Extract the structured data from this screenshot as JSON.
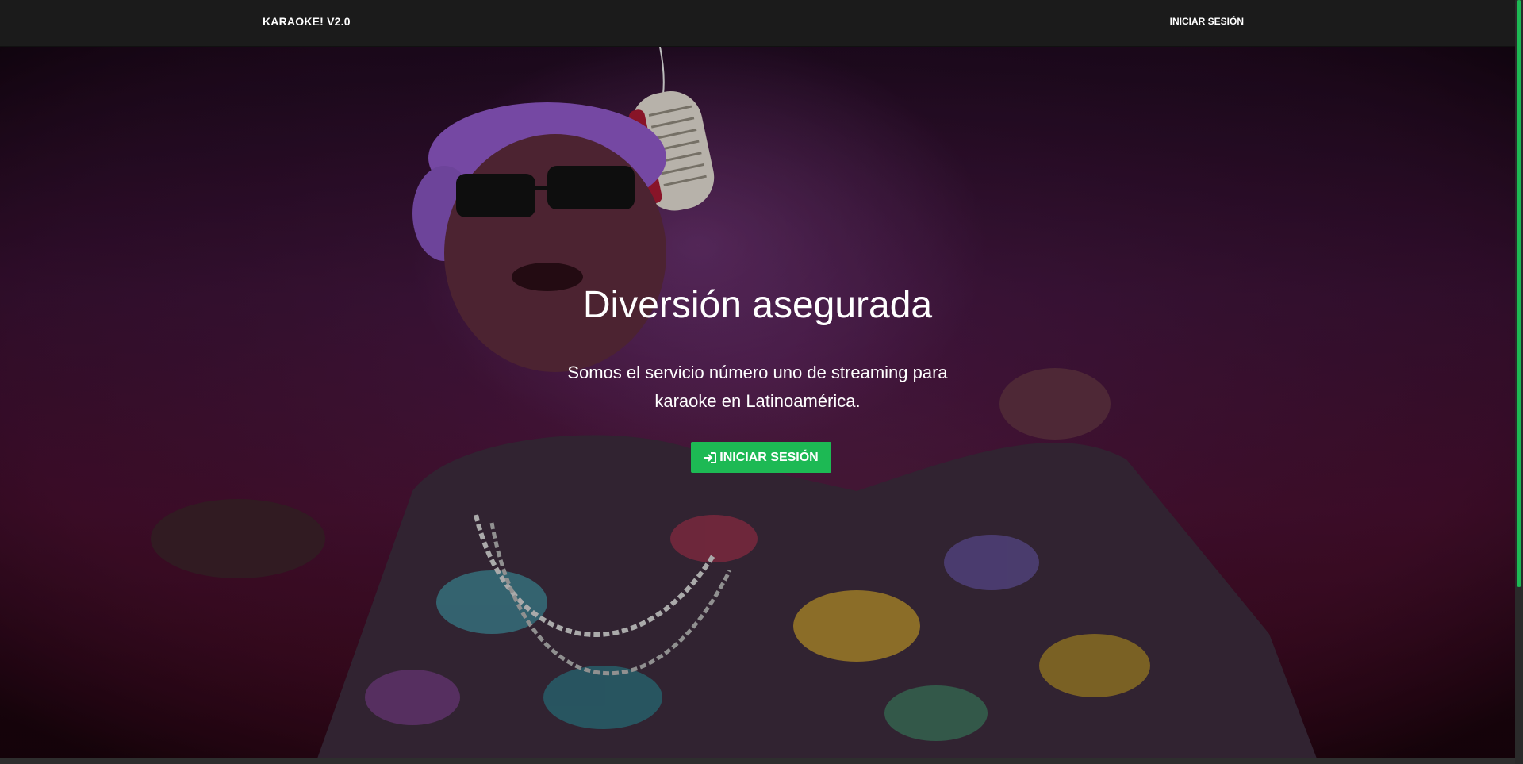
{
  "navbar": {
    "brand": "KARAOKE! V2.0",
    "login_label": "INICIAR SESIÓN"
  },
  "hero": {
    "title": "Diversión asegurada",
    "text": "Somos el servicio número uno de streaming para karaoke en Latinoamérica.",
    "button_label": "INICIAR SESIÓN",
    "button_icon": "sign-in-icon"
  },
  "colors": {
    "accent": "#1db954",
    "navbar_bg": "#1b1b1b",
    "hero_tint": "#4a1030"
  }
}
